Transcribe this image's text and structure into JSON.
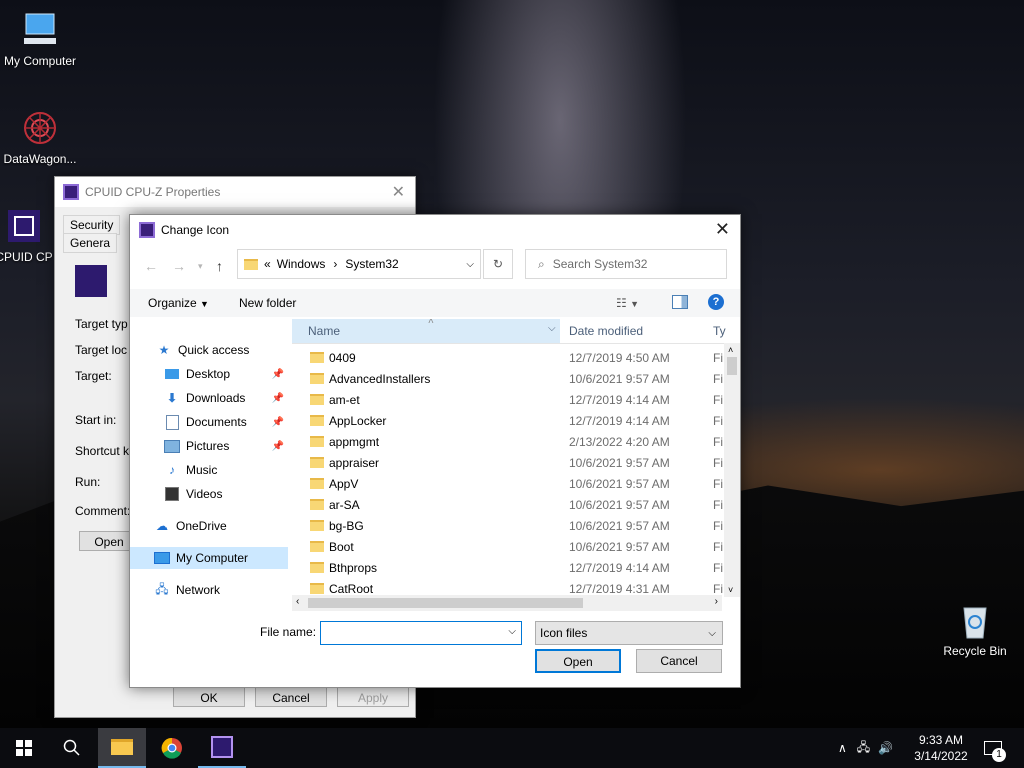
{
  "desktop": {
    "icons": [
      {
        "label": "My Computer"
      },
      {
        "label": "DataWagon..."
      },
      {
        "label": "CPUID CP"
      },
      {
        "label": "Recycle Bin"
      }
    ]
  },
  "props_window": {
    "title": "CPUID CPU-Z Properties",
    "tabs": [
      "Security",
      "Genera"
    ],
    "labels": [
      "Target typ",
      "Target loc",
      "Target:",
      "Start in:",
      "Shortcut k",
      "Run:",
      "Comment:"
    ],
    "open_button": "Open",
    "ok": "OK",
    "cancel": "Cancel",
    "apply": "Apply"
  },
  "dialog": {
    "title": "Change Icon",
    "address": {
      "prefix": "«",
      "crumb1": "Windows",
      "sep": "›",
      "crumb2": "System32"
    },
    "search_placeholder": "Search System32",
    "organize": "Organize",
    "new_folder": "New folder",
    "nav": [
      {
        "label": "Quick access",
        "icon": "star-icon"
      },
      {
        "label": "Desktop",
        "icon": "desktop-icon",
        "pinned": true
      },
      {
        "label": "Downloads",
        "icon": "download-icon",
        "pinned": true
      },
      {
        "label": "Documents",
        "icon": "document-icon",
        "pinned": true
      },
      {
        "label": "Pictures",
        "icon": "picture-icon",
        "pinned": true
      },
      {
        "label": "Music",
        "icon": "music-icon"
      },
      {
        "label": "Videos",
        "icon": "video-icon"
      },
      {
        "label": "OneDrive",
        "icon": "cloud-icon"
      },
      {
        "label": "My Computer",
        "icon": "computer-icon",
        "selected": true
      },
      {
        "label": "Network",
        "icon": "network-icon"
      }
    ],
    "columns": {
      "name": "Name",
      "date": "Date modified",
      "type": "Ty"
    },
    "files": [
      {
        "name": "0409",
        "date": "12/7/2019 4:50 AM",
        "type": "Fi"
      },
      {
        "name": "AdvancedInstallers",
        "date": "10/6/2021 9:57 AM",
        "type": "Fi"
      },
      {
        "name": "am-et",
        "date": "12/7/2019 4:14 AM",
        "type": "Fi"
      },
      {
        "name": "AppLocker",
        "date": "12/7/2019 4:14 AM",
        "type": "Fi"
      },
      {
        "name": "appmgmt",
        "date": "2/13/2022 4:20 AM",
        "type": "Fi"
      },
      {
        "name": "appraiser",
        "date": "10/6/2021 9:57 AM",
        "type": "Fi"
      },
      {
        "name": "AppV",
        "date": "10/6/2021 9:57 AM",
        "type": "Fi"
      },
      {
        "name": "ar-SA",
        "date": "10/6/2021 9:57 AM",
        "type": "Fi"
      },
      {
        "name": "bg-BG",
        "date": "10/6/2021 9:57 AM",
        "type": "Fi"
      },
      {
        "name": "Boot",
        "date": "10/6/2021 9:57 AM",
        "type": "Fi"
      },
      {
        "name": "Bthprops",
        "date": "12/7/2019 4:14 AM",
        "type": "Fi"
      },
      {
        "name": "CatRoot",
        "date": "12/7/2019 4:31 AM",
        "type": "Fi"
      }
    ],
    "file_name_label": "File name:",
    "file_name_value": "",
    "file_type": "Icon files",
    "open": "Open",
    "cancel": "Cancel"
  },
  "taskbar": {
    "time": "9:33 AM",
    "date": "3/14/2022",
    "notification_count": "1"
  },
  "colors": {
    "accent": "#0078d7",
    "taskbar": "#0b0c10",
    "selected_nav": "#cce8ff",
    "folder": "#f8d775"
  }
}
